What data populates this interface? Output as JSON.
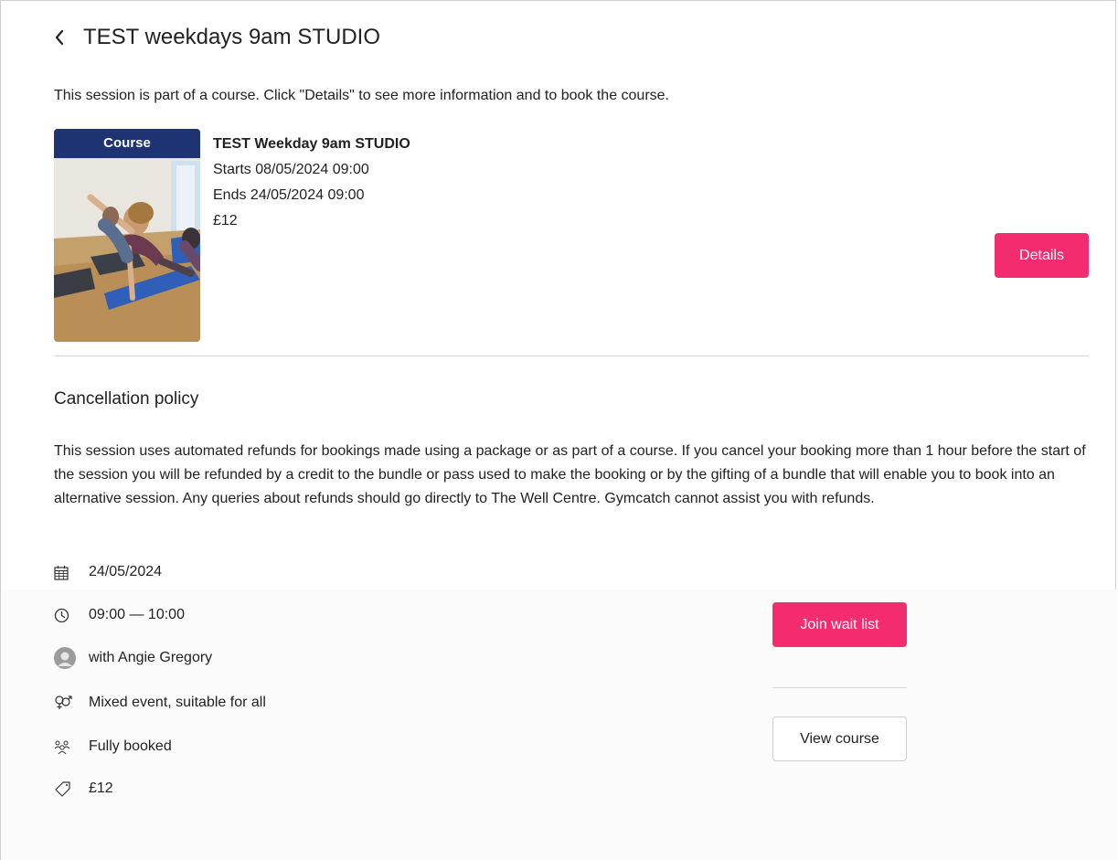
{
  "header": {
    "title": "TEST weekdays 9am STUDIO"
  },
  "intro": "This session is part of a course. Click \"Details\" to see more information and to book the course.",
  "course": {
    "badge": "Course",
    "name": "TEST Weekday 9am STUDIO",
    "starts": "Starts 08/05/2024 09:00",
    "ends": "Ends 24/05/2024 09:00",
    "price": "£12",
    "details_label": "Details"
  },
  "cancellation": {
    "heading": "Cancellation policy",
    "text": "This session uses automated refunds for bookings made using a package or as part of a course. If you cancel your booking more than 1 hour before the start of the session you will be refunded by a credit to the bundle or pass used to make the booking or by the gifting of a bundle that will enable you to book into an alternative session. Any queries about refunds should go directly to The Well Centre. Gymcatch cannot assist you with refunds."
  },
  "session": {
    "date": "24/05/2024",
    "time": "09:00 — 10:00",
    "instructor": "with Angie Gregory",
    "gender": "Mixed event, suitable for all",
    "availability": "Fully booked",
    "price": "£12"
  },
  "actions": {
    "join_wait_list": "Join wait list",
    "view_course": "View course"
  },
  "colors": {
    "accent": "#f22c6e",
    "badge": "#1e3472"
  }
}
